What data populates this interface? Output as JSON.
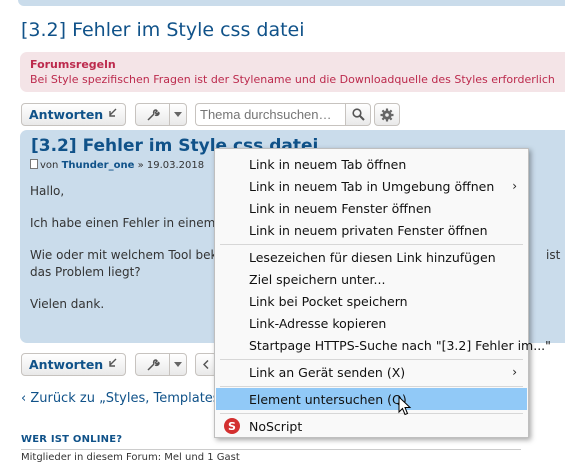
{
  "page": {
    "title": "[3.2] Fehler im Style css datei"
  },
  "rules": {
    "title": "Forumsregeln",
    "text": "Bei Style spezifischen Fragen ist der Stylename und die Downloadquelle des Styles erforderlich"
  },
  "toolbar": {
    "reply_label": "Antworten",
    "search_placeholder": "Thema durchsuchen…"
  },
  "post": {
    "title": "[3.2] Fehler im Style css datei",
    "meta_prefix": "von",
    "author": "Thunder_one",
    "date": "» 19.03.2018",
    "greeting": "Hallo,",
    "para1": "Ich habe einen Fehler in einem",
    "para2_line1": "Wie oder mit welchem Tool bek",
    "para2_line1_tail": "ist bz",
    "para2_line2": "das Problem liegt?",
    "thanks": "Vielen dank."
  },
  "back_link": "‹ Zurück zu „Styles, Templates",
  "who_online": {
    "heading": "WER IST ONLINE?",
    "text": "Mitglieder in diesem Forum: Mel  und 1 Gast"
  },
  "context_menu": {
    "items": [
      {
        "label": "Link in neuem Tab öffnen"
      },
      {
        "label": "Link in neuem Tab in Umgebung öffnen",
        "submenu": true
      },
      {
        "label": "Link in neuem Fenster öffnen"
      },
      {
        "label": "Link in neuem privaten Fenster öffnen"
      },
      {
        "label": "Lesezeichen für diesen Link hinzufügen"
      },
      {
        "label": "Ziel speichern unter..."
      },
      {
        "label": "Link bei Pocket speichern"
      },
      {
        "label": "Link-Adresse kopieren"
      },
      {
        "label": "Startpage HTTPS-Suche nach \"[3.2] Fehler im...\""
      },
      {
        "label": "Link an Gerät senden (X)",
        "submenu": true
      },
      {
        "label": "Element untersuchen (Q)",
        "highlighted": true
      },
      {
        "label": "NoScript"
      }
    ]
  },
  "icons": {
    "reply": "reply-arrow-icon",
    "tools": "wrench-icon",
    "dropdown": "caret-down-icon",
    "search": "magnifier-icon",
    "advanced": "gear-icon",
    "noscript": "noscript-s-icon",
    "submenu": "chevron-right-icon"
  },
  "colors": {
    "link_blue": "#105289",
    "rules_red": "#bc2a4d",
    "rules_bg": "#f4e4e7",
    "post_bg": "#cadceb",
    "menu_highlight": "#91c9f7"
  }
}
